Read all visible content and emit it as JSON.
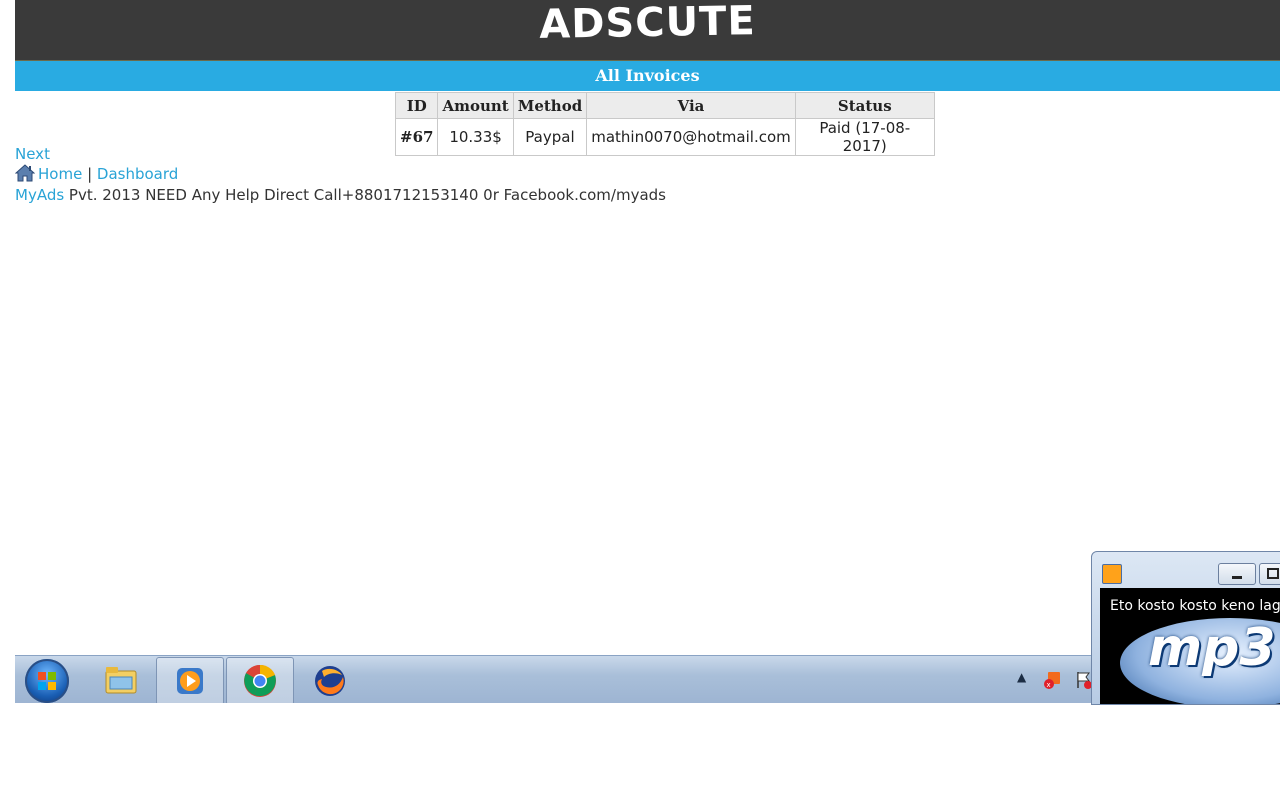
{
  "header": {
    "logo_text": "ADSCUTE"
  },
  "page": {
    "title": "All Invoices"
  },
  "invoices": {
    "columns": [
      "ID",
      "Amount",
      "Method",
      "Via",
      "Status"
    ],
    "rows": [
      {
        "id": "#67",
        "amount": "10.33$",
        "method": "Paypal",
        "via": "mathin0070@hotmail.com",
        "status": "Paid (17-08-2017)"
      }
    ]
  },
  "pagination": {
    "next_label": "Next"
  },
  "nav": {
    "home_label": "Home",
    "separator": "|",
    "dashboard_label": "Dashboard"
  },
  "footer": {
    "brand_link": "MyAds",
    "text": " Pvt. 2013 NEED Any Help Direct Call+8801712153140 0r Facebook.com/myads"
  },
  "taskbar": {
    "items": [
      {
        "icon": "windows-start-icon"
      },
      {
        "icon": "file-explorer-icon"
      },
      {
        "icon": "media-player-icon",
        "active": true
      },
      {
        "icon": "chrome-icon",
        "active": true
      },
      {
        "icon": "firefox-icon"
      }
    ]
  },
  "mini_player": {
    "track_title": "Eto kosto kosto keno lage",
    "art_text": "mp3"
  }
}
